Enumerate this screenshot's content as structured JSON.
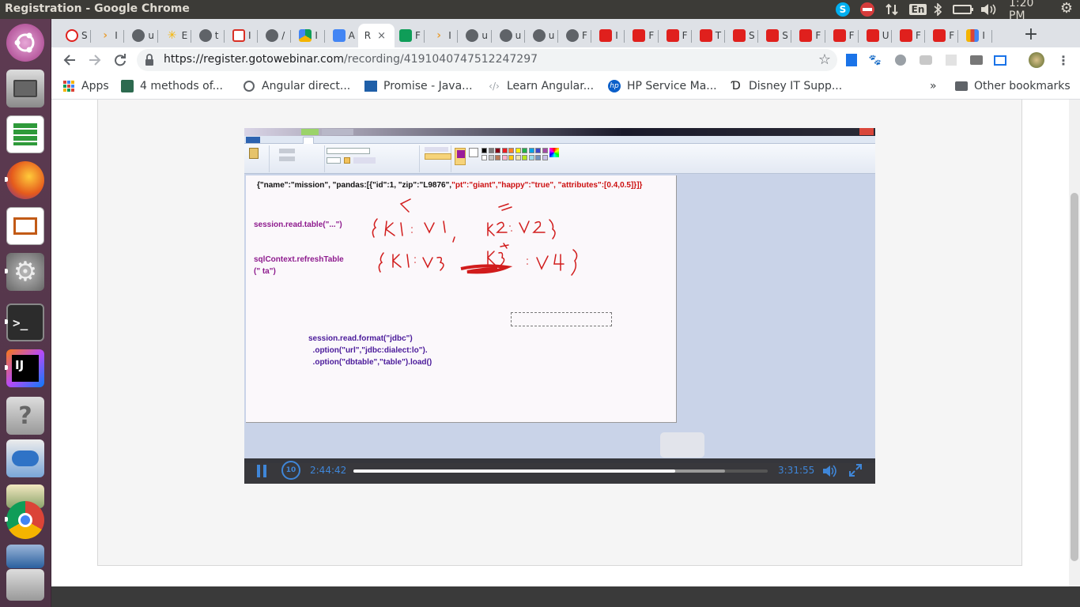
{
  "window": {
    "title": "Registration - Google Chrome"
  },
  "panel": {
    "skype_glyph": "S",
    "lang": "En",
    "clock": "1:20 PM",
    "icons": [
      "skype-icon",
      "block-icon",
      "network-icon",
      "keyboard-lang-icon",
      "bluetooth-icon",
      "battery-icon",
      "volume-icon",
      "settings-gear-icon"
    ]
  },
  "launcher": {
    "items": [
      "ubuntu-dash-icon",
      "files-icon",
      "libreoffice-calc-icon",
      "firefox-icon",
      "libreoffice-impress-icon",
      "system-settings-icon",
      "terminal-icon",
      "intellij-icon",
      "help-icon",
      "skype-app-icon",
      "chrome-icon",
      "virtualbox-icon",
      "drive-icon"
    ],
    "terminal_glyph": ">_",
    "intellij_glyph": "IJ",
    "help_glyph": "?"
  },
  "tabs": [
    {
      "label": "S",
      "icon": "opera-icon"
    },
    {
      "label": "I",
      "icon": "jira-icon"
    },
    {
      "label": "u",
      "icon": "globe-icon"
    },
    {
      "label": "E",
      "icon": "walmart-icon"
    },
    {
      "label": "t",
      "icon": "globe-icon"
    },
    {
      "label": "I",
      "icon": "gmail-icon"
    },
    {
      "label": "/",
      "icon": "globe-icon"
    },
    {
      "label": "I",
      "icon": "google-drive-icon"
    },
    {
      "label": "A",
      "icon": "google-docs-icon"
    },
    {
      "label": "R",
      "icon": "active-tab",
      "active": true
    },
    {
      "label": "F",
      "icon": "google-sheets-icon"
    },
    {
      "label": "I",
      "icon": "jira-icon"
    },
    {
      "label": "u",
      "icon": "globe-icon"
    },
    {
      "label": "u",
      "icon": "globe-icon"
    },
    {
      "label": "u",
      "icon": "globe-icon"
    },
    {
      "label": "F",
      "icon": "globe-icon"
    },
    {
      "label": "I",
      "icon": "makemytrip-icon"
    },
    {
      "label": "F",
      "icon": "makemytrip-icon"
    },
    {
      "label": "F",
      "icon": "makemytrip-icon"
    },
    {
      "label": "T",
      "icon": "makemytrip-icon"
    },
    {
      "label": "S",
      "icon": "makemytrip-icon"
    },
    {
      "label": "S",
      "icon": "makemytrip-icon"
    },
    {
      "label": "F",
      "icon": "makemytrip-icon"
    },
    {
      "label": "F",
      "icon": "makemytrip-icon"
    },
    {
      "label": "U",
      "icon": "makemytrip-icon"
    },
    {
      "label": "F",
      "icon": "makemytrip-icon"
    },
    {
      "label": "F",
      "icon": "makemytrip-icon"
    },
    {
      "label": "I",
      "icon": "chart-icon"
    }
  ],
  "active_tab_close": "×",
  "new_tab": "+",
  "address": {
    "host": "https://register.gotowebinar.com",
    "path": "/recording/4191040747512247297"
  },
  "bookmarks": [
    {
      "label": "Apps",
      "icon": "apps-grid-icon"
    },
    {
      "label": "4 methods of...",
      "icon": "avatar-icon"
    },
    {
      "label": "Angular direct...",
      "icon": "globe-icon"
    },
    {
      "label": "Promise - Java...",
      "icon": "mdn-icon"
    },
    {
      "label": "Learn Angular...",
      "icon": "code-icon"
    },
    {
      "label": "HP Service Ma...",
      "icon": "hp-icon"
    },
    {
      "label": "Disney IT Supp...",
      "icon": "disney-icon"
    }
  ],
  "bookmarks_overflow": "»",
  "other_bookmarks": "Other bookmarks",
  "video": {
    "json_line_black": "{\"name\":\"mission\", \"pandas:[{\"id\":1, \"zip\":\"L9876\",",
    "json_line_red": "\"pt\":\"giant\",\"happy\":\"true\",  \"attributes\":[0.4,0.5]}]}",
    "line1": "session.read.table(\"...\")",
    "line2a": "sqlContext.refreshTable",
    "line2b": "(\" ta\")",
    "line3a": "session.read.format(\"jdbc\")",
    "line3b": "  .option(\"url\",\"jdbc:dialect:lo\").",
    "line3c": "  .option(\"dbtable\",\"table\").load()",
    "handwriting_row1": "{ K1 : V1 ,   K2 : V2 }",
    "handwriting_row2": "{ K1 : V3   K3 : V4 }"
  },
  "player": {
    "current_time": "2:44:42",
    "total_time": "3:31:55",
    "replay_label": "10",
    "progress": 0.776,
    "buffered": 0.897
  },
  "colors": {
    "accent_blue": "#3f86d8",
    "json_red": "#cc1010",
    "code_purple": "#8e1b8e",
    "code_indigo": "#4a1a9a",
    "ink_red": "#d11c1c"
  }
}
